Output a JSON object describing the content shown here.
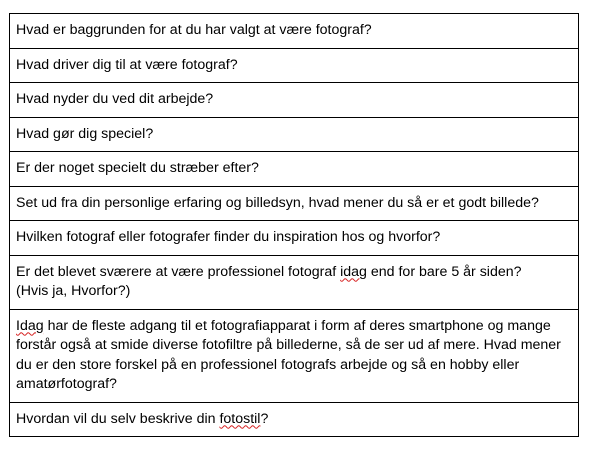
{
  "questions": [
    {
      "text": "Hvad er baggrunden for at du har valgt at være fotograf?"
    },
    {
      "text": "Hvad driver dig til at være fotograf?"
    },
    {
      "text": "Hvad nyder du ved dit arbejde?"
    },
    {
      "text": "Hvad gør dig speciel?"
    },
    {
      "text": "Er der noget specielt du stræber efter?"
    },
    {
      "text": "Set ud fra din personlige erfaring og billedsyn, hvad mener du så er et godt billede?"
    },
    {
      "text": "Hvilken fotograf eller fotografer finder du inspiration hos og hvorfor?"
    },
    {
      "before": "Er det blevet sværere at være professionel fotograf ",
      "flagged": "idag",
      "after": " end for bare 5 år siden?\n(Hvis ja, Hvorfor?)"
    },
    {
      "flagged": "Idag",
      "after": " har de fleste adgang til et fotografiapparat i form af deres smartphone og mange forstår også at smide diverse fotofiltre på billederne, så de ser ud af mere. Hvad mener du er den store forskel på en professionel fotografs arbejde og så en hobby eller amatørfotograf?"
    },
    {
      "before": "Hvordan vil du selv beskrive din ",
      "flagged": "fotostil",
      "after": "?"
    }
  ]
}
